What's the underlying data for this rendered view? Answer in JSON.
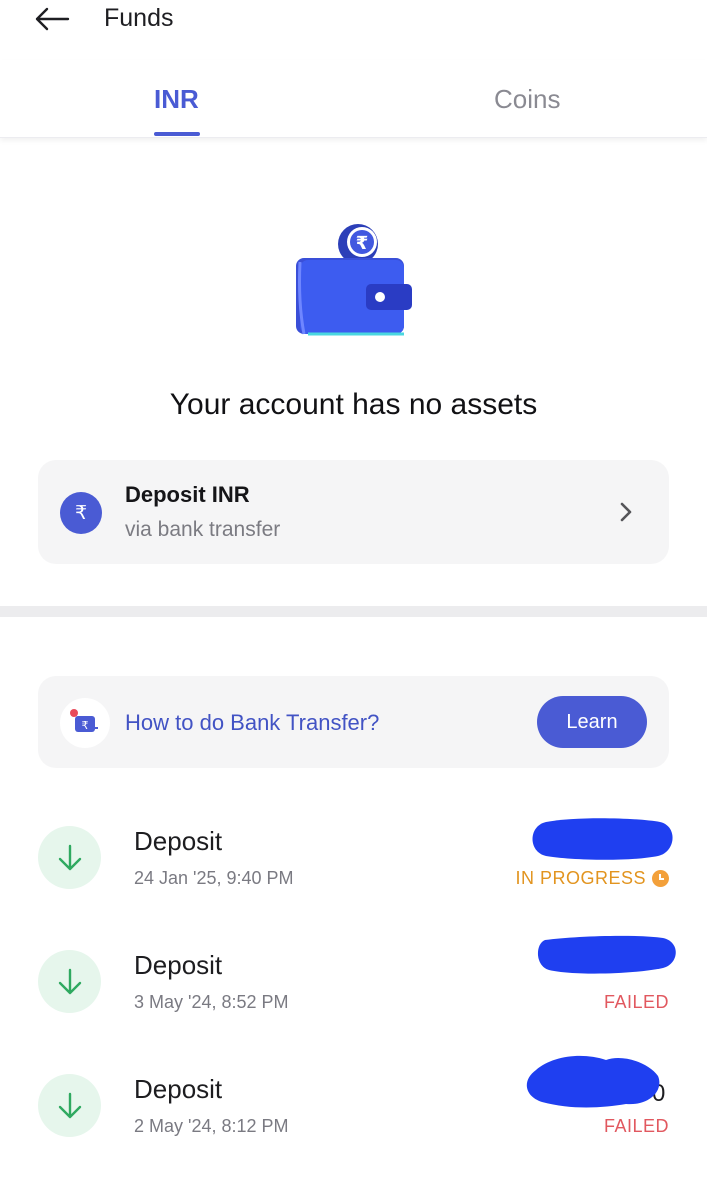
{
  "header": {
    "title": "Funds",
    "back_icon": "arrow-left-icon"
  },
  "tabs": [
    {
      "label": "INR",
      "active": true
    },
    {
      "label": "Coins",
      "active": false
    }
  ],
  "empty_state": {
    "title": "Your account has no assets",
    "illustration": "wallet-icon"
  },
  "deposit_card": {
    "title": "Deposit INR",
    "subtitle": "via bank transfer",
    "icon_symbol": "₹"
  },
  "learn_card": {
    "text": "How to do Bank Transfer?",
    "button_label": "Learn"
  },
  "transactions": [
    {
      "type": "Deposit",
      "date": "24 Jan '25, 9:40 PM",
      "status": "IN PROGRESS",
      "status_color": "#e2941f",
      "amount_visible_tail": ""
    },
    {
      "type": "Deposit",
      "date": "3 May '24, 8:52 PM",
      "status": "FAILED",
      "status_color": "#e1585f",
      "amount_visible_tail": ""
    },
    {
      "type": "Deposit",
      "date": "2 May '24, 8:12 PM",
      "status": "FAILED",
      "status_color": "#e1585f",
      "amount_visible_tail": "0"
    }
  ],
  "colors": {
    "accent": "#4a5bd4",
    "deposit_icon_bg": "#e6f6ec",
    "deposit_icon_arrow": "#2fa960",
    "redaction": "#1f3ff0"
  }
}
